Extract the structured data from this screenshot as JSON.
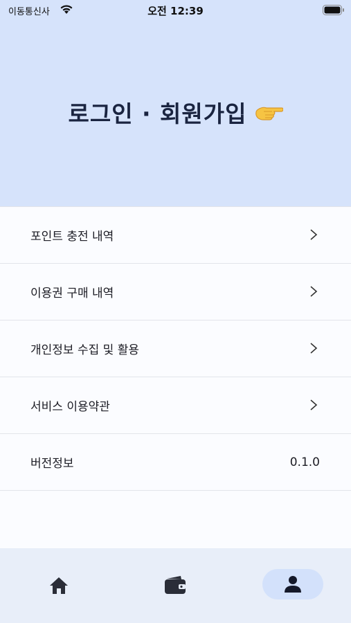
{
  "status_bar": {
    "carrier": "이동통신사",
    "time": "오전 12:39",
    "wifi_icon": "wifi-icon",
    "battery_icon": "battery-icon"
  },
  "header": {
    "title": "로그인 · 회원가입",
    "emoji_icon": "pointing-hand-icon",
    "background": "#d6e3fb"
  },
  "menu": {
    "items": [
      {
        "label": "포인트 충전 내역",
        "icon": "chevron-right-icon"
      },
      {
        "label": "이용권 구매 내역",
        "icon": "chevron-right-icon"
      },
      {
        "label": "개인정보 수집 및 활용",
        "icon": "chevron-right-icon"
      },
      {
        "label": "서비스 이용약관",
        "icon": "chevron-right-icon"
      }
    ],
    "version": {
      "label": "버전정보",
      "value": "0.1.0"
    }
  },
  "tabbar": {
    "tabs": [
      {
        "icon": "home-icon",
        "selected": false
      },
      {
        "icon": "wallet-icon",
        "selected": false
      },
      {
        "icon": "person-icon",
        "selected": true
      }
    ],
    "background": "#e8eef9",
    "selected_pill": "#d3e1fb"
  }
}
